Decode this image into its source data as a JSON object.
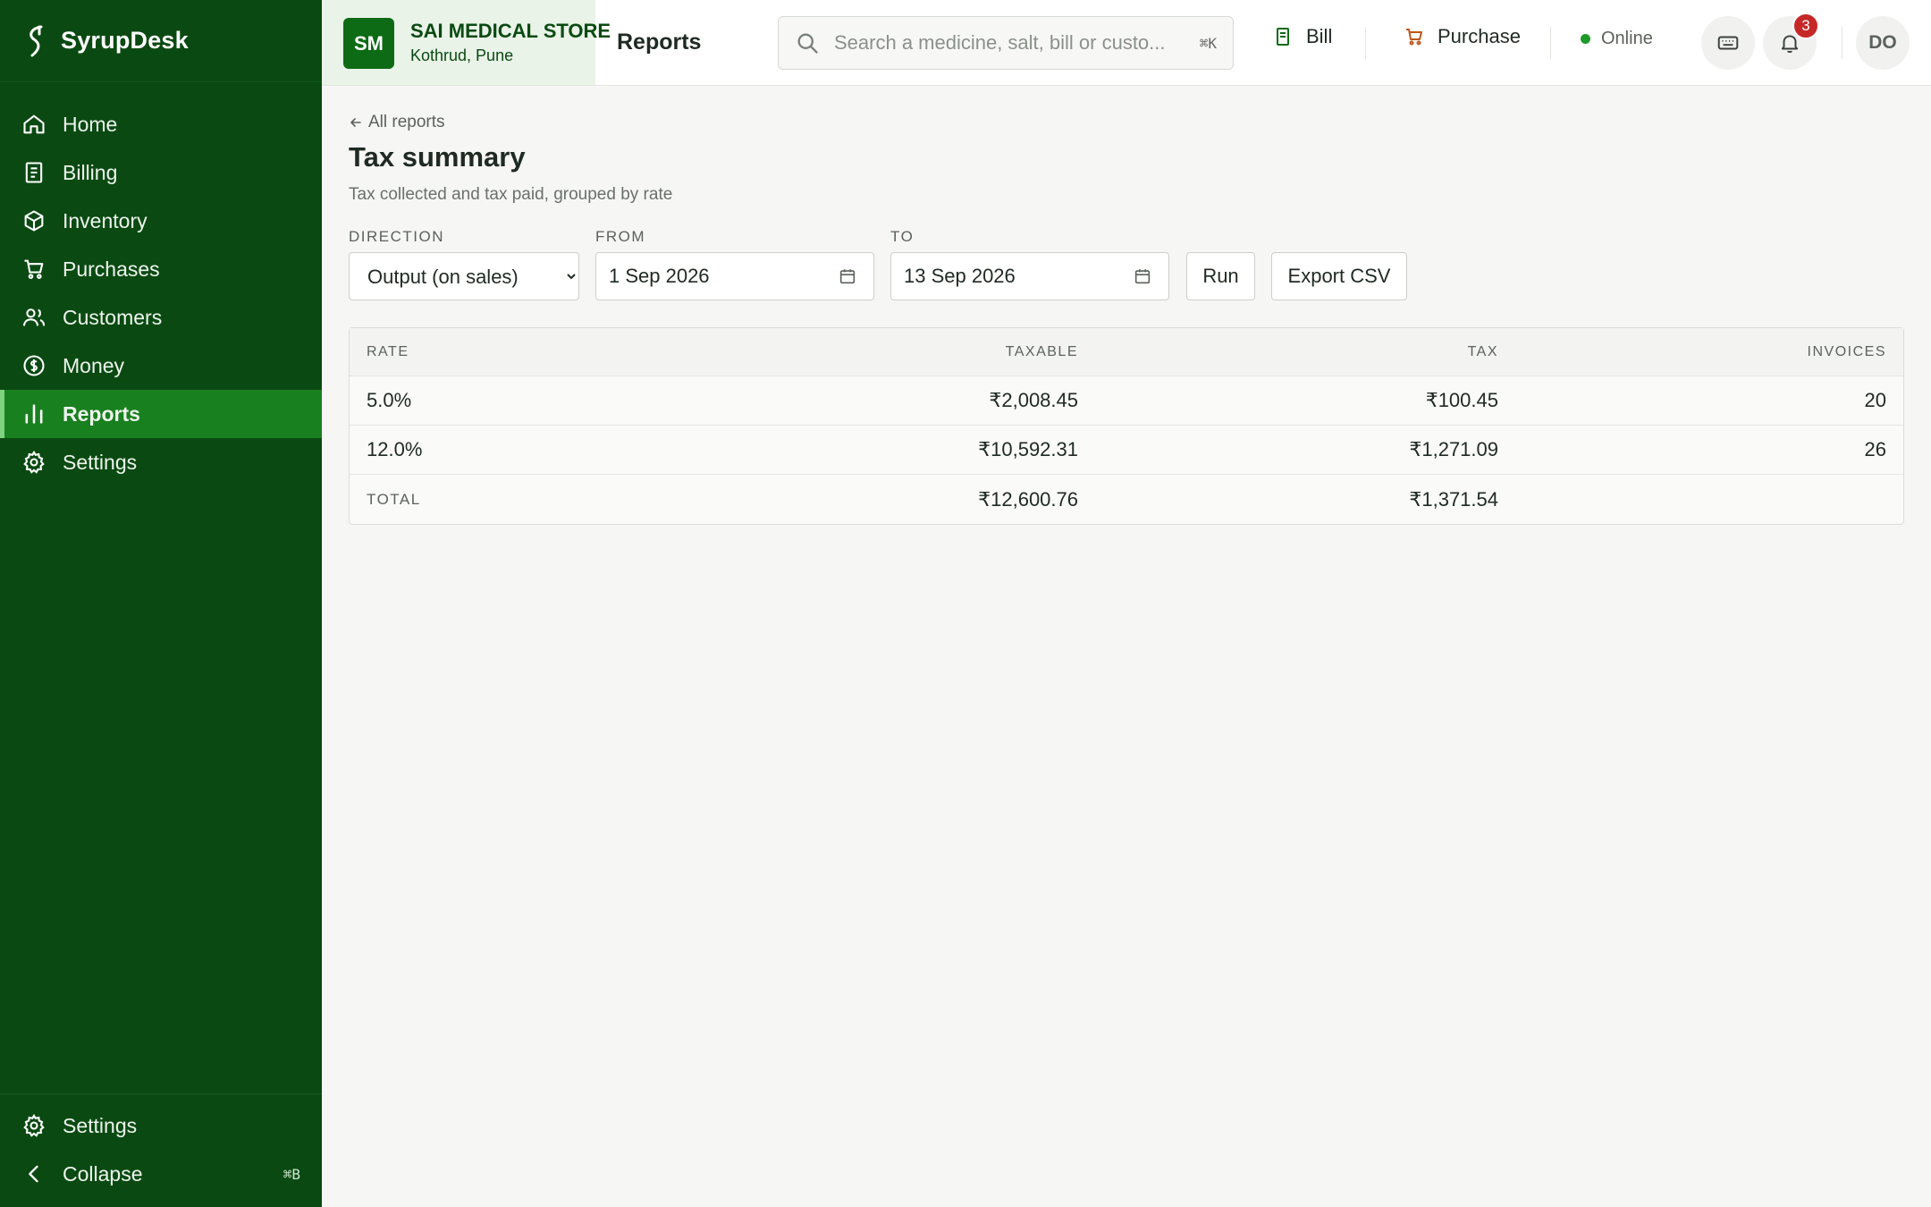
{
  "app": {
    "name": "SyrupDesk"
  },
  "sidebar": {
    "items": [
      {
        "label": "Home",
        "icon": "home-icon"
      },
      {
        "label": "Billing",
        "icon": "receipt-icon"
      },
      {
        "label": "Inventory",
        "icon": "box-icon"
      },
      {
        "label": "Purchases",
        "icon": "cart-icon"
      },
      {
        "label": "Customers",
        "icon": "users-icon"
      },
      {
        "label": "Money",
        "icon": "currency-icon"
      },
      {
        "label": "Reports",
        "icon": "bar-chart-icon",
        "active": true
      },
      {
        "label": "Settings",
        "icon": "gear-icon"
      }
    ],
    "bottom": {
      "settings_label": "Settings",
      "collapse_label": "Collapse",
      "collapse_shortcut": "⌘B"
    }
  },
  "store": {
    "initials": "SM",
    "name": "SAI MEDICAL STORE",
    "location": "Kothrud, Pune"
  },
  "topbar": {
    "title": "Reports",
    "search_placeholder": "Search a medicine, salt, bill or custo...",
    "search_shortcut": "⌘K",
    "bill_label": "Bill",
    "purchase_label": "Purchase",
    "status_label": "Online",
    "notification_count": "3",
    "user_initials": "DO"
  },
  "page": {
    "back_label": "All reports",
    "title": "Tax summary",
    "subtitle": "Tax collected and tax paid, grouped by rate"
  },
  "filters": {
    "direction_label": "DIRECTION",
    "direction_value": "Output (on sales)",
    "direction_options": [
      "Output (on sales)"
    ],
    "from_label": "FROM",
    "from_value": "1 Sep 2026",
    "to_label": "TO",
    "to_value": "13 Sep 2026",
    "run_label": "Run",
    "export_label": "Export CSV"
  },
  "table": {
    "columns": [
      "RATE",
      "TAXABLE",
      "TAX",
      "INVOICES"
    ],
    "rows": [
      {
        "rate": "5.0%",
        "taxable": "₹2,008.45",
        "tax": "₹100.45",
        "invoices": "20"
      },
      {
        "rate": "12.0%",
        "taxable": "₹10,592.31",
        "tax": "₹1,271.09",
        "invoices": "26"
      }
    ],
    "total": {
      "label": "TOTAL",
      "taxable": "₹12,600.76",
      "tax": "₹1,371.54",
      "invoices": ""
    }
  },
  "colors": {
    "sidebar_bg": "#0a4a12",
    "active_bg": "#19801f",
    "status_online": "#1f9a2a",
    "badge": "#c62828",
    "purchase_accent": "#c0561b"
  }
}
